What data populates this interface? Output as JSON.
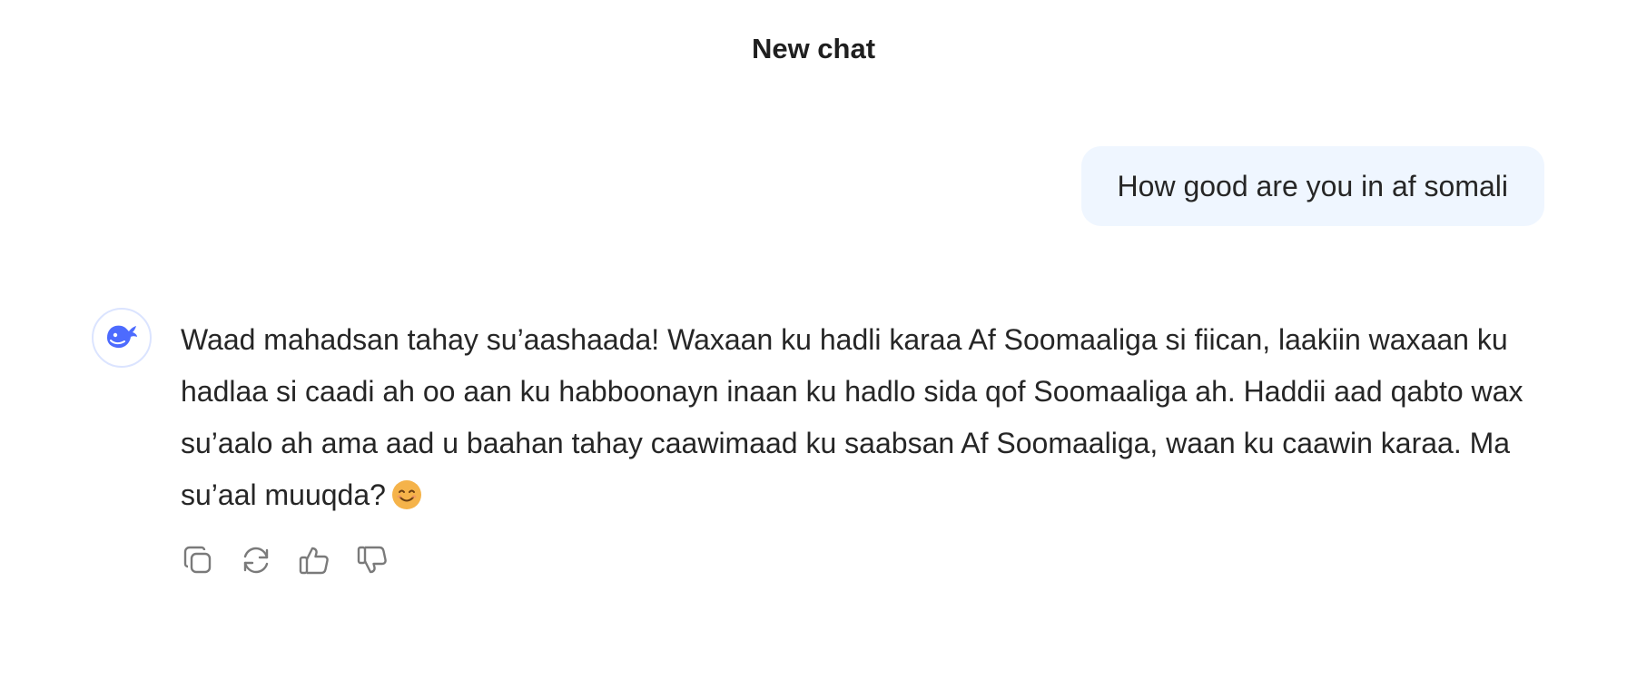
{
  "header": {
    "title": "New chat"
  },
  "conversation": {
    "user_message": "How good are you in af somali",
    "assistant_message": "Waad mahadsan tahay su’aashaada! Waxaan ku hadli karaa Af Soomaaliga si fiican, laakiin waxaan ku hadlaa si caadi ah oo aan ku habboonayn inaan ku hadlo sida qof Soomaaliga ah. Haddii aad qabto wax su’aalo ah ama aad u baahan tahay caawimaad ku saabsan Af Soomaaliga, waan ku caawin karaa. Ma su’aal muuqda?",
    "assistant_emoji_icon": "smiling-face-emoji",
    "assistant_avatar_icon": "whale-logo-icon"
  },
  "actions": [
    {
      "icon": "copy-icon"
    },
    {
      "icon": "regenerate-icon"
    },
    {
      "icon": "thumbs-up-icon"
    },
    {
      "icon": "thumbs-down-icon"
    }
  ],
  "colors": {
    "user_bubble_bg": "#eff6ff",
    "brand_blue": "#4d6bfe",
    "icon_gray": "#7a7a7a",
    "text": "#262626"
  }
}
